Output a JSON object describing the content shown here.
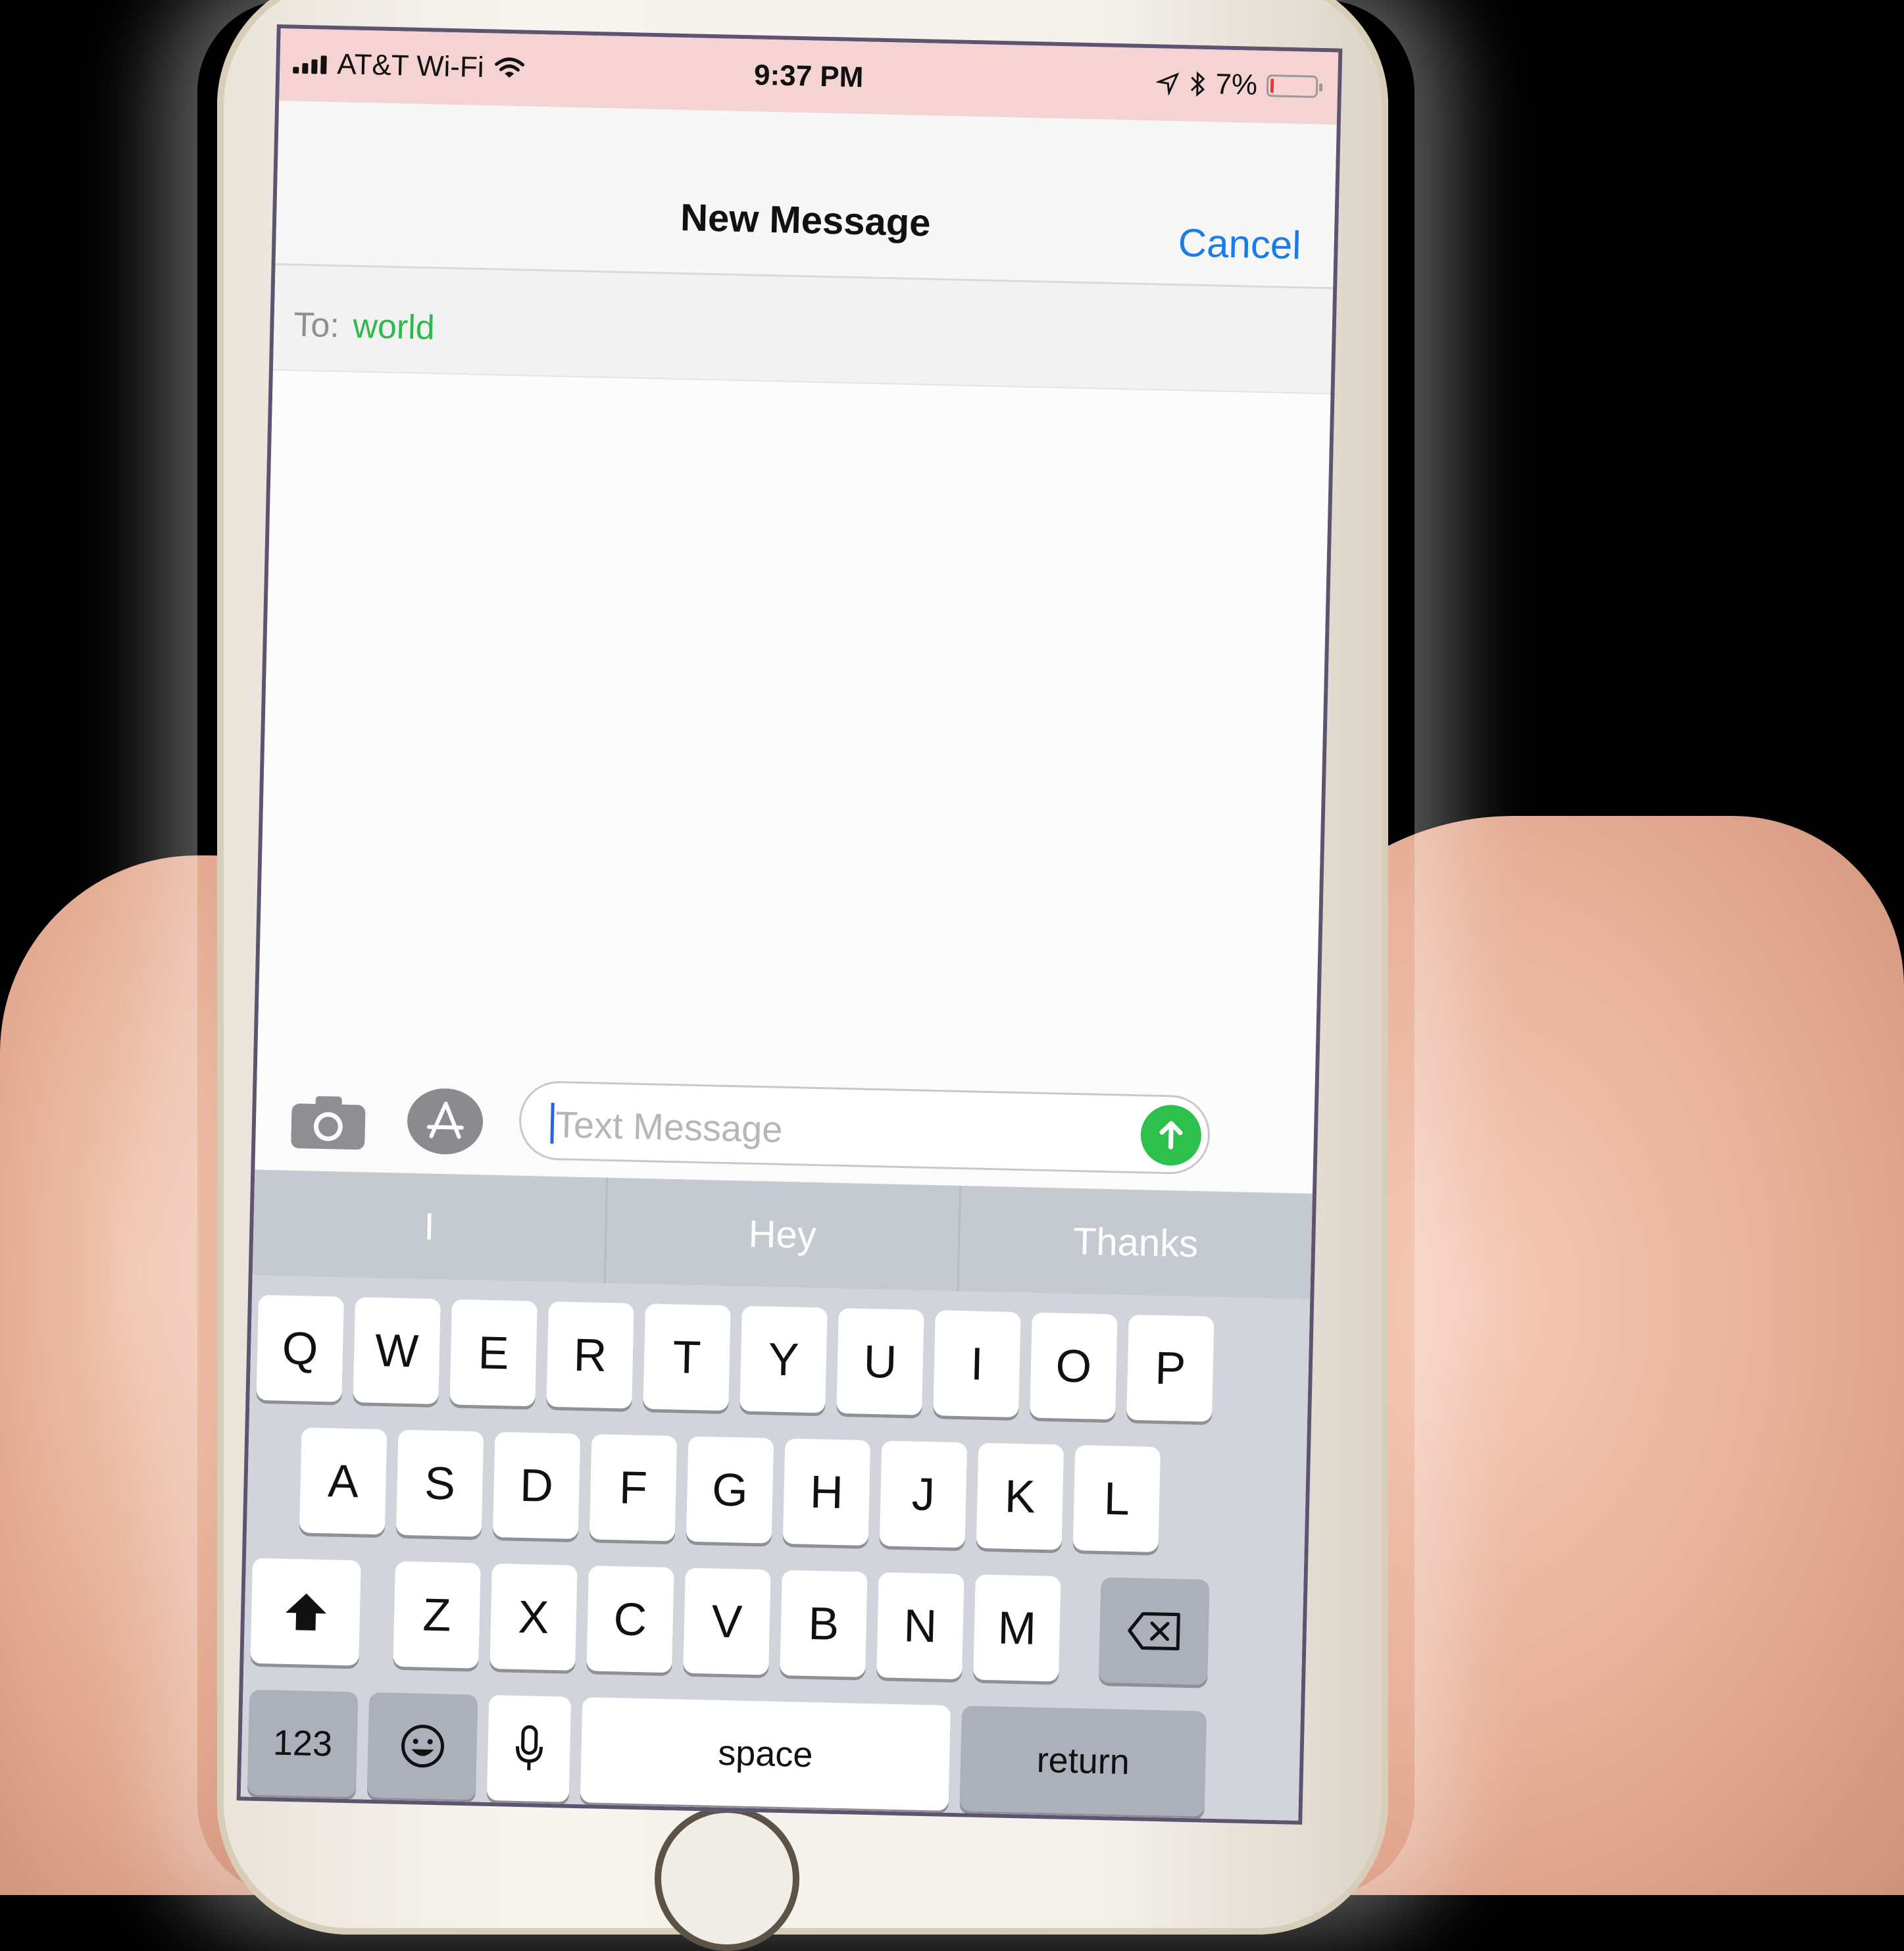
{
  "status_bar": {
    "carrier": "AT&T Wi-Fi",
    "time": "9:37 PM",
    "battery_percent": "7%",
    "icons": [
      "signal-bars-icon",
      "wifi-icon",
      "location-arrow-icon",
      "bluetooth-icon",
      "battery-icon"
    ]
  },
  "nav": {
    "title": "New Message",
    "cancel_label": "Cancel"
  },
  "recipient": {
    "label": "To:",
    "value": "world"
  },
  "compose": {
    "placeholder": "Text Message",
    "camera_icon": "camera-icon",
    "appstore_icon": "app-store-icon",
    "send_icon": "arrow-up-icon"
  },
  "keyboard": {
    "suggestions": [
      "I",
      "Hey",
      "Thanks"
    ],
    "row1": [
      "Q",
      "W",
      "E",
      "R",
      "T",
      "Y",
      "U",
      "I",
      "O",
      "P"
    ],
    "row2": [
      "A",
      "S",
      "D",
      "F",
      "G",
      "H",
      "J",
      "K",
      "L"
    ],
    "row3": [
      "Z",
      "X",
      "C",
      "V",
      "B",
      "N",
      "M"
    ],
    "numbers_label": "123",
    "space_label": "space",
    "return_label": "return",
    "shift_icon": "shift-icon",
    "delete_icon": "delete-icon",
    "emoji_icon": "emoji-icon",
    "mic_icon": "microphone-icon"
  },
  "colors": {
    "accent_blue": "#1b7be8",
    "recipient_green": "#2fb94a",
    "send_green": "#2ec04d",
    "status_bg": "#f5d3d3"
  }
}
